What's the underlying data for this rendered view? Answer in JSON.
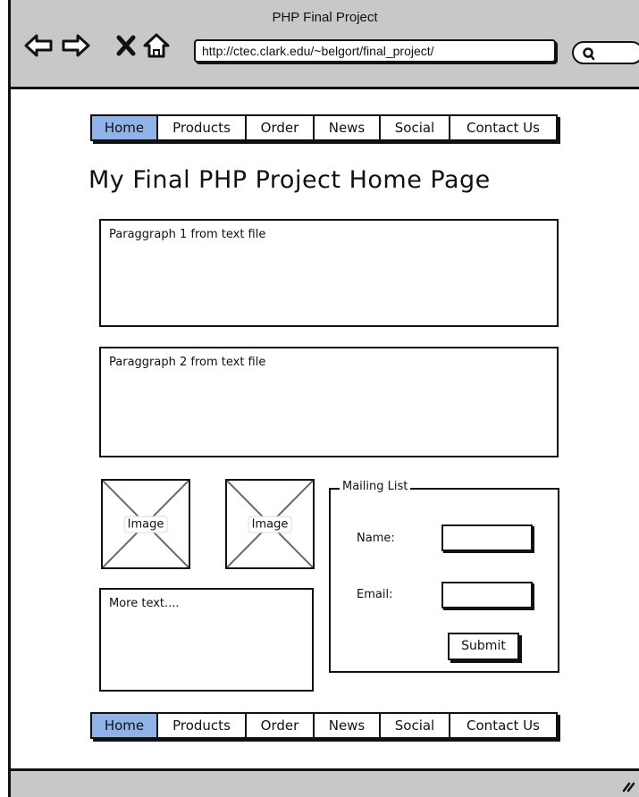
{
  "browser": {
    "title": "PHP Final Project",
    "url": "http://ctec.clark.edu/~belgort/final_project/",
    "icons": [
      "back-arrow-icon",
      "forward-arrow-icon",
      "stop-icon",
      "home-icon",
      "search-icon",
      "resize-grip-icon"
    ]
  },
  "nav_top": {
    "items": [
      "Home",
      "Products",
      "Order",
      "News",
      "Social",
      "Contact Us"
    ],
    "active": "Home"
  },
  "page": {
    "heading": "My Final PHP Project Home Page",
    "paragraph1": "Paraggraph 1 from text file",
    "paragraph2": "Paraggraph 2 from text file",
    "image1_label": "Image",
    "image2_label": "Image",
    "more_text": "More text...."
  },
  "mailing_list": {
    "legend": "Mailing List",
    "name_label": "Name:",
    "email_label": "Email:",
    "name_value": "",
    "email_value": "",
    "submit_label": "Submit"
  },
  "nav_bottom": {
    "items": [
      "Home",
      "Products",
      "Order",
      "News",
      "Social",
      "Contact Us"
    ],
    "active": "Home"
  },
  "colors": {
    "chrome": "#c8c8c8",
    "active_tab": "#8fb3e8",
    "stroke": "#111111"
  }
}
